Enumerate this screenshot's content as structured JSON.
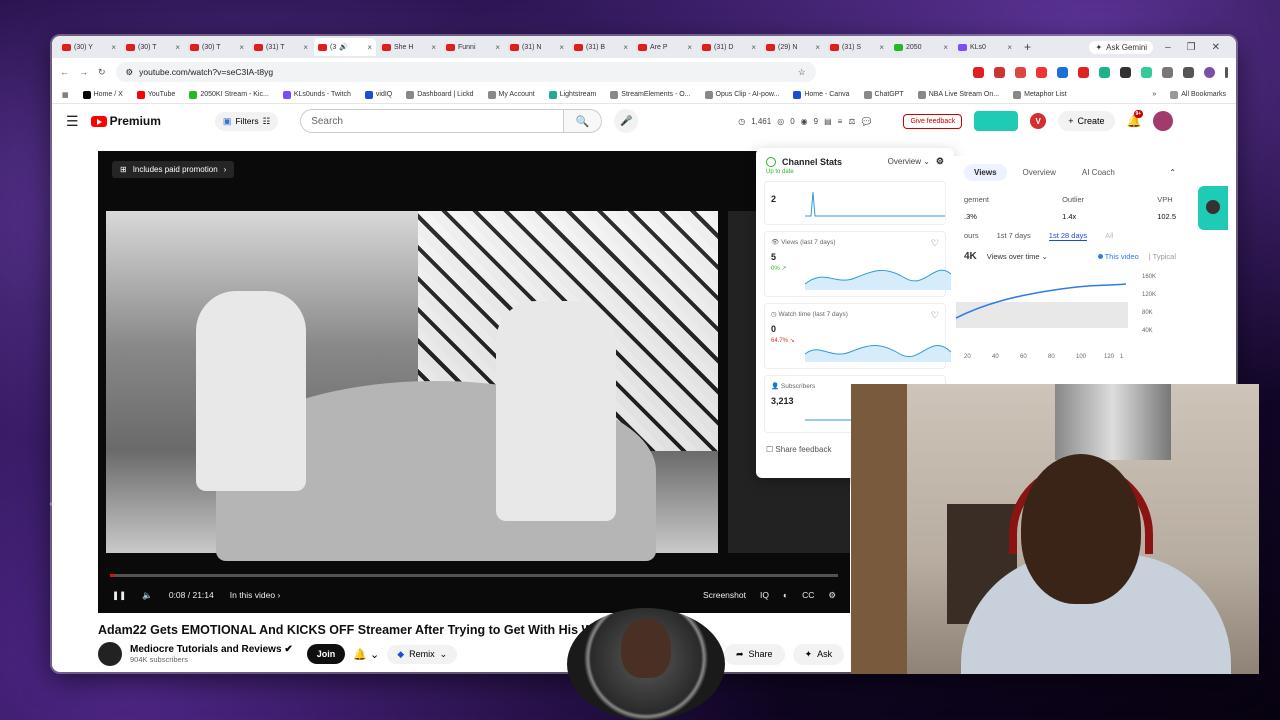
{
  "browser": {
    "tabs": [
      {
        "label": "(30) Y",
        "icon": "youtube-icon"
      },
      {
        "label": "(30) T",
        "icon": "youtube-icon"
      },
      {
        "label": "(30) T",
        "icon": "youtube-icon"
      },
      {
        "label": "(31) T",
        "icon": "youtube-icon"
      },
      {
        "label": "(3",
        "icon": "youtube-icon",
        "active": true
      },
      {
        "label": "She H",
        "icon": "youtube-icon"
      },
      {
        "label": "Funni",
        "icon": "youtube-icon"
      },
      {
        "label": "(31) N",
        "icon": "youtube-icon"
      },
      {
        "label": "(31) B",
        "icon": "youtube-icon"
      },
      {
        "label": "Are P",
        "icon": "youtube-icon"
      },
      {
        "label": "(31) D",
        "icon": "youtube-icon"
      },
      {
        "label": "(29) N",
        "icon": "youtube-icon"
      },
      {
        "label": "(31) S",
        "icon": "youtube-icon"
      },
      {
        "label": "2050",
        "icon": "kick-icon"
      },
      {
        "label": "KLs0",
        "icon": "twitch-icon"
      }
    ],
    "new_tab": "+",
    "gemini_label": "Ask Gemini",
    "url": "youtube.com/watch?v=seC3IA-t8yg",
    "bookmarks": [
      {
        "label": "Home / X"
      },
      {
        "label": "YouTube"
      },
      {
        "label": "2050KI Stream - Kic..."
      },
      {
        "label": "KLs0unds - Twitch"
      },
      {
        "label": "vidIQ"
      },
      {
        "label": "Dashboard | Lickd"
      },
      {
        "label": "My Account"
      },
      {
        "label": "Lightstream"
      },
      {
        "label": "StreamElements - O..."
      },
      {
        "label": "Opus Clip - AI-pow..."
      },
      {
        "label": "Home - Canva"
      },
      {
        "label": "ChatGPT"
      },
      {
        "label": "NBA Live Stream On..."
      },
      {
        "label": "Metaphor List"
      }
    ],
    "all_bookmarks": "All Bookmarks"
  },
  "youtube": {
    "logo_text": "Premium",
    "filters_label": "Filters",
    "search_placeholder": "Search",
    "header_stats": [
      "1,461",
      "0",
      "9"
    ],
    "give_feedback": "Give feedback",
    "create_label": "Create",
    "notif_badge": "9+",
    "video": {
      "paid_promo": "Includes paid promotion",
      "time": "0:08 / 21:14",
      "in_this_video": "In this video",
      "screenshot_label": "Screenshot",
      "progress_fraction": 0.006
    },
    "title": "Adam22 Gets EMOTIONAL And KICKS OFF Streamer After Trying to Get With His Wife",
    "channel_name": "Mediocre Tutorials and Reviews",
    "subscribers": "904K subscribers",
    "join_label": "Join",
    "remix_label": "Remix",
    "share_label": "Share",
    "ask_label": "Ask"
  },
  "channel_stats": {
    "title": "Channel Stats",
    "view_select": "Overview",
    "status": "Up to date",
    "cards": [
      {
        "label": "",
        "value": "2",
        "change": ""
      },
      {
        "label": "Views (last 7 days)",
        "value": "5",
        "change": "0% ↗"
      },
      {
        "label": "Watch time (last 7 days)",
        "value": "0",
        "change": "64.7% ↘"
      },
      {
        "label": "Subscribers",
        "value": "3,213",
        "change": ""
      }
    ],
    "share_feedback": "Share feedback"
  },
  "analytics": {
    "tabs": [
      "Views",
      "Overview",
      "AI Coach"
    ],
    "metrics": [
      {
        "label": "gement",
        "value": ".3%"
      },
      {
        "label": "Outlier",
        "value": "1.4x"
      },
      {
        "label": "VPH",
        "value": "102.5"
      }
    ],
    "ranges": [
      "ours",
      "1st 7 days",
      "1st 28 days",
      "All"
    ],
    "total": "4K",
    "views_select": "Views over time",
    "legend": [
      "This video",
      "Typical"
    ],
    "yticks": [
      "160K",
      "120K",
      "80K",
      "40K"
    ],
    "xticks": [
      "20",
      "40",
      "60",
      "80",
      "100",
      "120",
      "1"
    ]
  },
  "colors": {
    "youtube_red": "#ff0000",
    "teal_accent": "#1fcbb4",
    "link_blue": "#1a4dd8"
  }
}
